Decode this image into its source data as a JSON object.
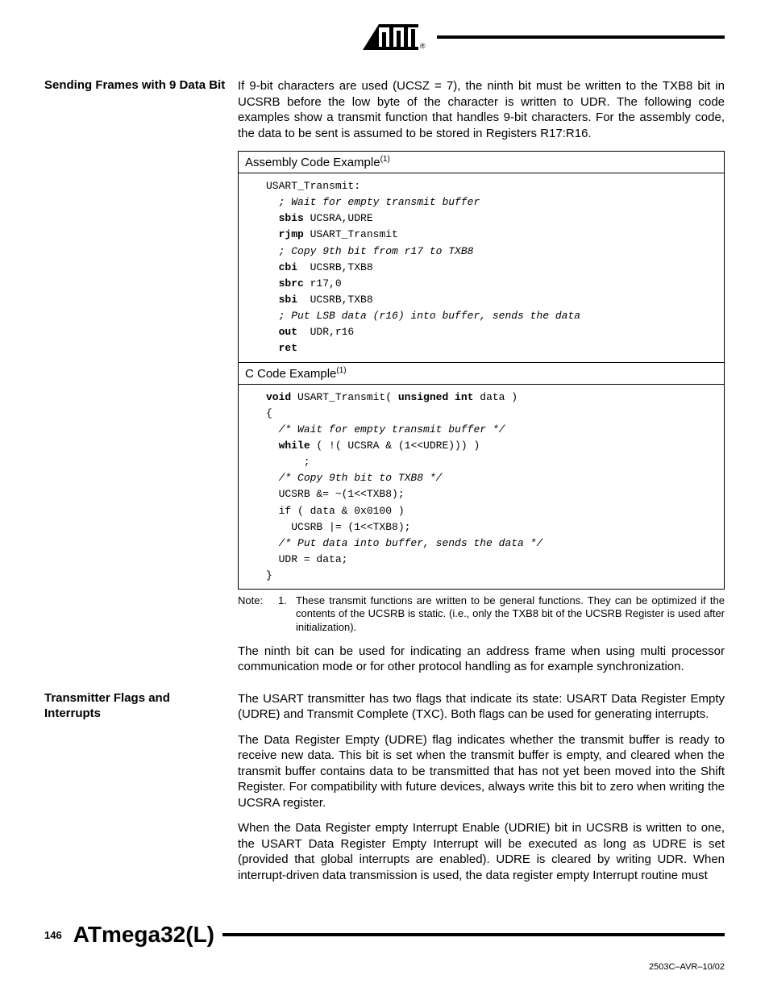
{
  "header": {
    "logo_alt": "Atmel"
  },
  "section1": {
    "heading": "Sending Frames with 9 Data Bit",
    "para1": "If 9-bit characters are used (UCSZ = 7), the ninth bit must be written to the TXB8 bit in UCSRB before the low byte of the character is written to UDR. The following code examples show a transmit function that handles 9-bit characters. For the assembly code, the data to be sent is assumed to be stored in Registers R17:R16.",
    "asm_title": "Assembly Code Example",
    "asm_sup": "(1)",
    "asm": {
      "l0": "USART_Transmit:",
      "c1": "; Wait for empty transmit buffer",
      "k2": "sbis",
      "a2": " UCSRA,UDRE",
      "k3": "rjmp",
      "a3": " USART_Transmit",
      "c4": "; Copy 9th bit from r17 to TXB8",
      "k5": "cbi",
      "a5": "  UCSRB,TXB8",
      "k6": "sbrc",
      "a6": " r17,0",
      "k7": "sbi",
      "a7": "  UCSRB,TXB8",
      "c8": "; Put LSB data (r16) into buffer, sends the data",
      "k9": "out",
      "a9": "  UDR,r16",
      "k10": "ret"
    },
    "c_title": "C Code Example",
    "c_sup": "(1)",
    "c": {
      "kvoid": "void",
      "fn": " USART_Transmit( ",
      "kuint": "unsigned int",
      "fn2": " data )",
      "ob": "{",
      "c1": "/* Wait for empty transmit buffer */",
      "kwhile": "while",
      "wcond": " ( !( UCSRA & (1<<UDRE))) )",
      "wsemi": "      ;",
      "c2": "/* Copy 9th bit to TXB8 */",
      "l1": "UCSRB &= ~(1<<TXB8);",
      "l2": "if ( data & 0x0100 )",
      "l3": "  UCSRB |= (1<<TXB8);",
      "c3": "/* Put data into buffer, sends the data */",
      "l4": "UDR = data;",
      "cb": "}"
    },
    "note_label": "Note:",
    "note_num": "1.",
    "note_text": "These transmit functions are written to be general functions. They can be optimized if the contents of the UCSRB is static. (i.e., only the TXB8 bit of the UCSRB Register is used after initialization).",
    "para2": "The ninth bit can be used for indicating an address frame when using multi processor communication mode or for other protocol handling as for example synchronization."
  },
  "section2": {
    "heading": "Transmitter Flags and Interrupts",
    "para1": "The USART transmitter has two flags that indicate its state: USART Data Register Empty (UDRE) and Transmit Complete (TXC). Both flags can be used for generating interrupts.",
    "para2": "The Data Register Empty (UDRE) flag indicates whether the transmit buffer is ready to receive new data. This bit is set when the transmit buffer is empty, and cleared when the transmit buffer contains data to be transmitted that has not yet been moved into the Shift Register. For compatibility with future devices, always write this bit to zero when writing the UCSRA register.",
    "para3": "When the Data Register empty Interrupt Enable (UDRIE) bit in UCSRB is written to one, the USART Data Register Empty Interrupt will be executed as long as UDRE is set (provided that global interrupts are enabled). UDRE is cleared by writing UDR. When interrupt-driven data transmission is used, the data register empty Interrupt routine must"
  },
  "footer": {
    "page": "146",
    "title": "ATmega32(L)",
    "docid": "2503C–AVR–10/02"
  }
}
